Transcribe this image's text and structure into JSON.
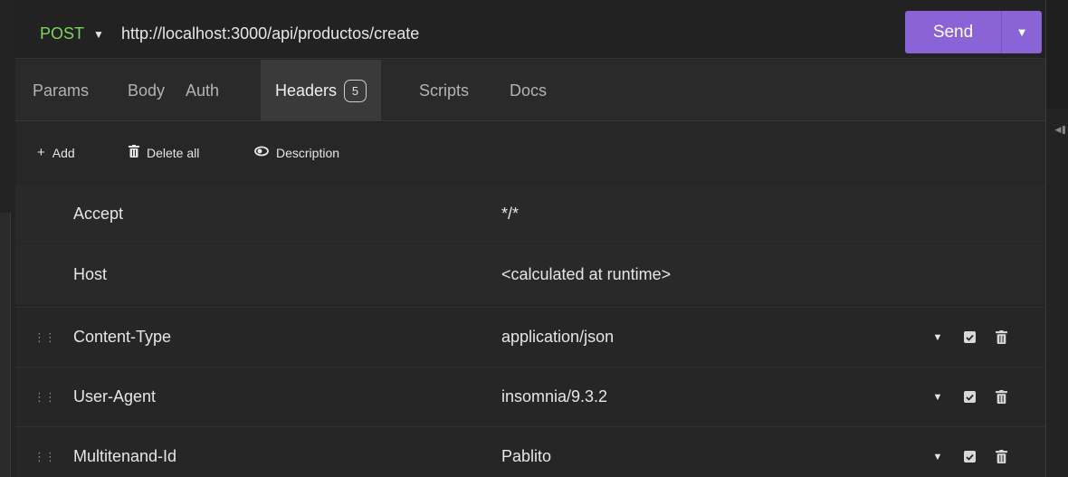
{
  "request": {
    "method": "POST",
    "url": "http://localhost:3000/api/productos/create",
    "send_label": "Send"
  },
  "tabs": [
    {
      "label": "Params"
    },
    {
      "label": "Body"
    },
    {
      "label": "Auth"
    },
    {
      "label": "Headers",
      "badge": "5",
      "active": true
    },
    {
      "label": "Scripts"
    },
    {
      "label": "Docs"
    }
  ],
  "toolbar": {
    "add_label": "Add",
    "delete_all_label": "Delete all",
    "description_label": "Description"
  },
  "auto_headers": [
    {
      "name": "Accept",
      "value": "*/*"
    },
    {
      "name": "Host",
      "value": "<calculated at runtime>"
    }
  ],
  "headers": [
    {
      "name": "Content-Type",
      "value": "application/json",
      "enabled": true
    },
    {
      "name": "User-Agent",
      "value": "insomnia/9.3.2",
      "enabled": true
    },
    {
      "name": "Multitenand-Id",
      "value": "Pablito",
      "enabled": true
    }
  ],
  "colors": {
    "accent": "#8a64d6",
    "method_post": "#7fd35f"
  }
}
